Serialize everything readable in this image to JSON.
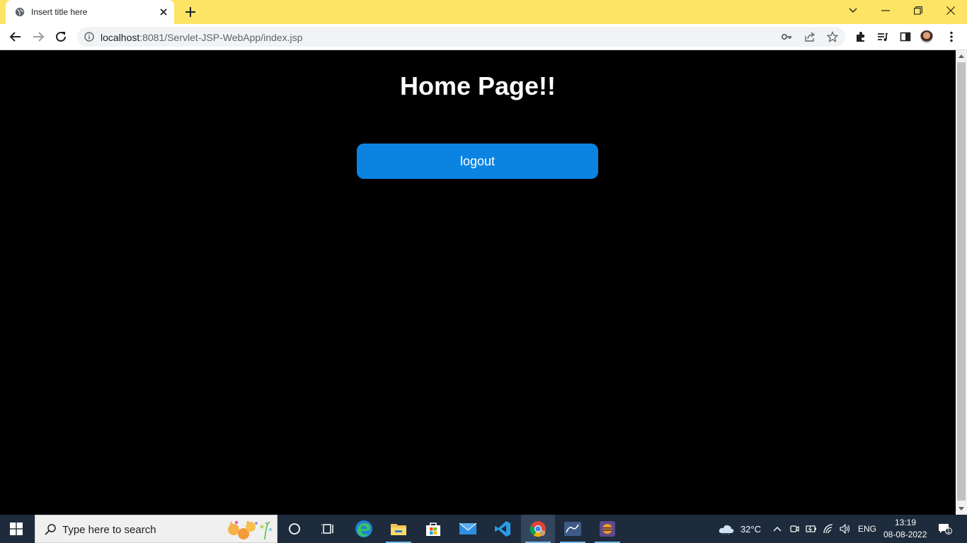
{
  "browser": {
    "tab": {
      "title": "Insert title here",
      "favicon": "globe-icon"
    },
    "omnibox": {
      "url_host": "localhost",
      "url_rest": ":8081/Servlet-JSP-WebApp/index.jsp"
    },
    "theme_color": "#fde464"
  },
  "page": {
    "heading": "Home Page!!",
    "logout_label": "logout",
    "background_color": "#000000",
    "button_color": "#0a84e0"
  },
  "taskbar": {
    "search_placeholder": "Type here to search",
    "apps": [
      "cortana-icon",
      "task-view-icon",
      "edge-icon",
      "file-explorer-icon",
      "microsoft-store-icon",
      "mail-icon",
      "vscode-icon",
      "chrome-icon",
      "mysql-workbench-icon",
      "eclipse-icon"
    ],
    "weather": "32°C",
    "language": "ENG",
    "time": "13:19",
    "date": "08-08-2022",
    "notification_count": "1"
  }
}
